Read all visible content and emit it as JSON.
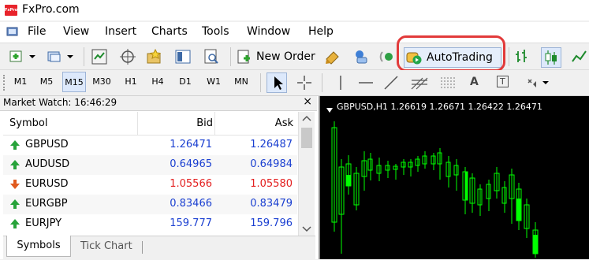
{
  "app": {
    "logo_text": "FxPro",
    "title": "FxPro.com"
  },
  "menu": [
    "File",
    "View",
    "Insert",
    "Charts",
    "Tools",
    "Window",
    "Help"
  ],
  "toolbar": {
    "new_order_label": "New Order",
    "autotrading_label": "AutoTrading"
  },
  "timeframes": [
    "M1",
    "M5",
    "M15",
    "M30",
    "H1",
    "H4",
    "D1",
    "W1",
    "MN"
  ],
  "timeframe_active": "M15",
  "text_tool_label": "A",
  "text_label_tool": "T",
  "market_watch": {
    "title": "Market Watch: 16:46:29",
    "close": "×",
    "columns": {
      "symbol": "Symbol",
      "bid": "Bid",
      "ask": "Ask"
    },
    "rows": [
      {
        "symbol": "GBPUSD",
        "bid": "1.26471",
        "ask": "1.26487",
        "direction": "up",
        "color": "#1a3fd1"
      },
      {
        "symbol": "AUDUSD",
        "bid": "0.64965",
        "ask": "0.64984",
        "direction": "up",
        "color": "#1a3fd1"
      },
      {
        "symbol": "EURUSD",
        "bid": "1.05566",
        "ask": "1.05580",
        "direction": "down",
        "color": "#e32020"
      },
      {
        "symbol": "EURGBP",
        "bid": "0.83466",
        "ask": "0.83479",
        "direction": "up",
        "color": "#1a3fd1"
      },
      {
        "symbol": "EURJPY",
        "bid": "159.777",
        "ask": "159.796",
        "direction": "up",
        "color": "#1a3fd1"
      }
    ],
    "tabs": [
      "Symbols",
      "Tick Chart"
    ],
    "active_tab": "Symbols"
  },
  "chart": {
    "header": "GBPUSD,H1  1.26619 1.26671 1.26422 1.26471",
    "candle_color": "#00ff00"
  }
}
